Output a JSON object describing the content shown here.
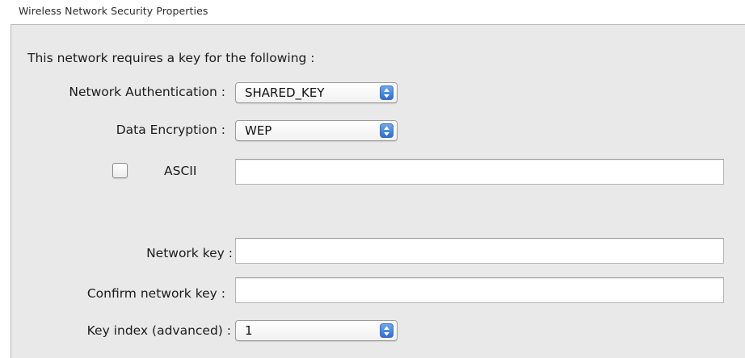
{
  "group": {
    "title": "Wireless Network Security Properties"
  },
  "form": {
    "intro": "This network requires a key for the following :",
    "authentication": {
      "label": "Network Authentication :",
      "value": "SHARED_KEY"
    },
    "encryption": {
      "label": "Data Encryption :",
      "value": "WEP"
    },
    "ascii": {
      "label": "ASCII",
      "checked": false,
      "value": ""
    },
    "network_key": {
      "label": "Network key :",
      "value": ""
    },
    "confirm_key": {
      "label": "Confirm network key :",
      "value": ""
    },
    "key_index": {
      "label": "Key index (advanced) :",
      "value": "1"
    }
  },
  "icons": {
    "popup_arrows": "up-down-arrows-icon"
  },
  "colors": {
    "panel_background": "#e9e9e9",
    "popup_arrow_accent": "#2e6fd0"
  }
}
